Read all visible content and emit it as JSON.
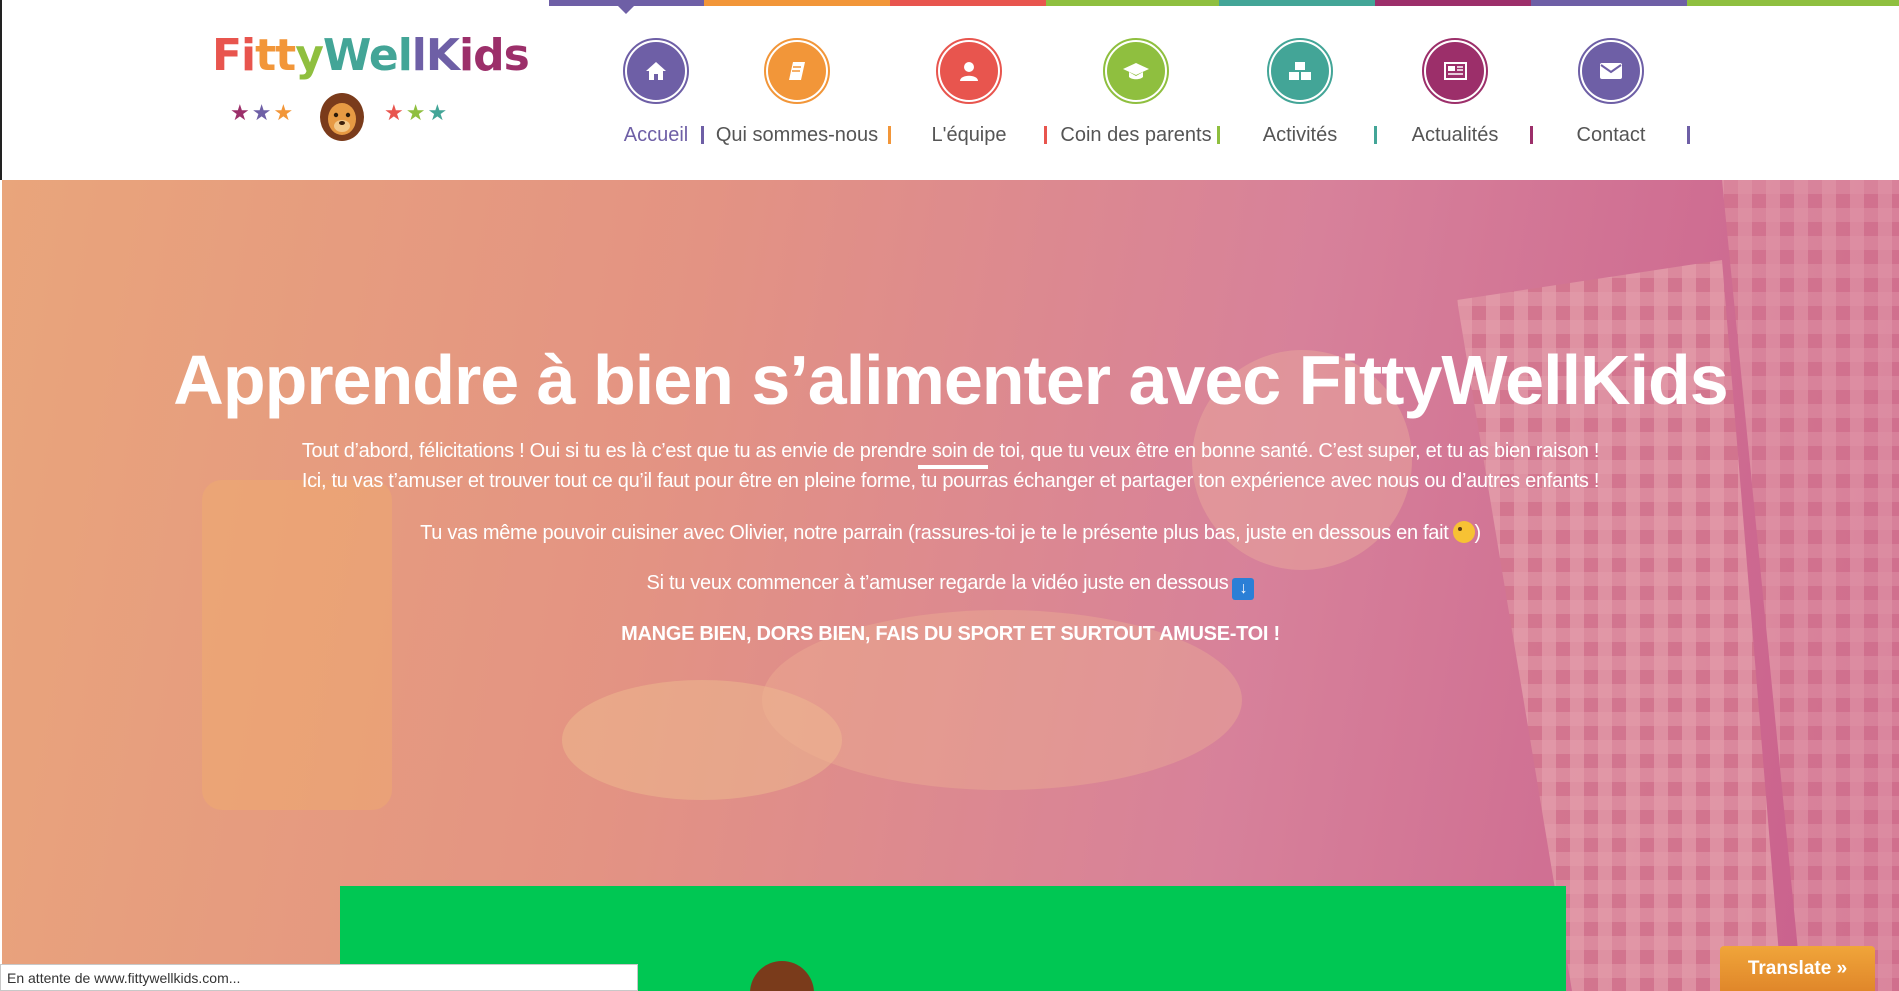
{
  "logo": {
    "text_parts": [
      "Fi",
      "tt",
      "y",
      "Wel",
      "lK",
      "ids"
    ],
    "stars_left": "★★★",
    "stars_right": "★★★",
    "alt": "FittyWellKids"
  },
  "nav": {
    "bar_colors": [
      "#6e5fa6",
      "#f29639",
      "#e8554e",
      "#8fbf3f",
      "#43a597",
      "#9c2f6a",
      "#6e5fa6",
      "#8fbf3f"
    ],
    "items": [
      {
        "label": "Accueil",
        "icon": "home-icon",
        "color": "#6e5fa6",
        "active": true
      },
      {
        "label": "Qui sommes-nous",
        "icon": "book-icon",
        "color": "#f29639",
        "active": false
      },
      {
        "label": "L'équipe",
        "icon": "user-icon",
        "color": "#e8554e",
        "active": false
      },
      {
        "label": "Coin des parents",
        "icon": "graduation-cap-icon",
        "color": "#8fbf3f",
        "active": false
      },
      {
        "label": "Activités",
        "icon": "cubes-icon",
        "color": "#43a597",
        "active": false
      },
      {
        "label": "Actualités",
        "icon": "newspaper-icon",
        "color": "#9c2f6a",
        "active": false
      },
      {
        "label": "Contact",
        "icon": "envelope-icon",
        "color": "#6e5fa6",
        "active": false
      }
    ]
  },
  "hero": {
    "title": "Apprendre à bien s’alimenter avec FittyWellKids",
    "line1": "Tout d’abord, félicitations ! Oui si tu es là c’est que tu as envie de prendre soin de toi, que tu veux être en bonne santé. C’est super, et tu as bien raison !",
    "line2": "Ici, tu vas t’amuser et trouver tout ce qu’il faut pour être en pleine forme, tu pourras échanger et partager ton expérience avec nous ou d’autres enfants !",
    "line3": "Tu vas même pouvoir cuisiner avec Olivier, notre parrain (rassures-toi je te le présente plus bas, juste en dessous en fait",
    "line3_end": ")",
    "line4": "Si tu veux commencer à t’amuser regarde la vidéo juste en dessous",
    "line5": "MANGE BIEN, DORS BIEN, FAIS DU SPORT ET SURTOUT AMUSE-TOI !"
  },
  "status_bar": {
    "text": "En attente de www.fittywellkids.com..."
  },
  "translate": {
    "label": "Translate »"
  }
}
